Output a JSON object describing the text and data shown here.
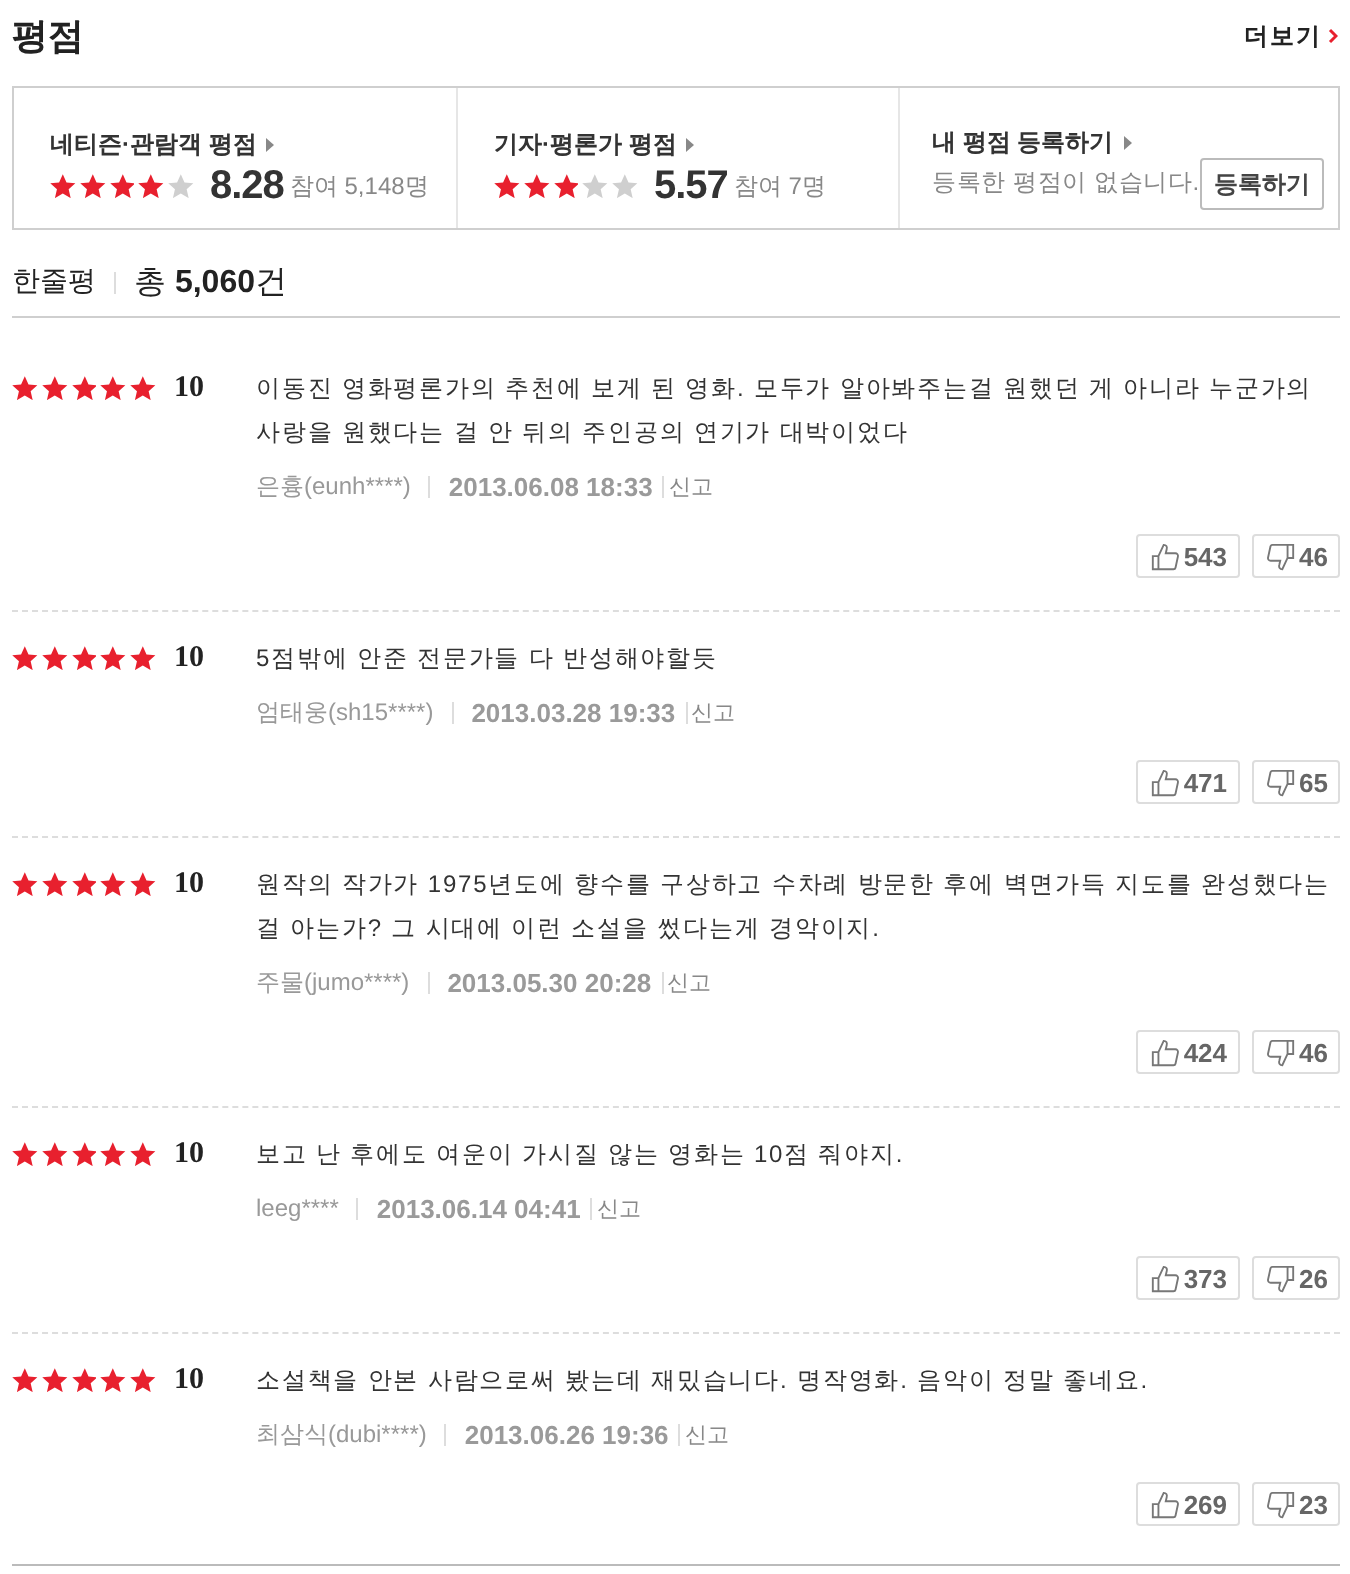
{
  "title": "평점",
  "more_link": {
    "label": "더보기"
  },
  "summary": [
    {
      "kind": "rating",
      "label": "네티즌·관람객 평점",
      "stars": 4,
      "score": "8.28",
      "participants": "참여 5,148명"
    },
    {
      "kind": "rating",
      "label": "기자·평론가 평점",
      "stars": 3,
      "score": "5.57",
      "participants": "참여 7명"
    },
    {
      "kind": "register",
      "label": "내 평점 등록하기",
      "message": "등록한 평점이 없습니다.",
      "button": "등록하기"
    }
  ],
  "comments_header": {
    "label": "한줄평",
    "total": "총 **5,060**건"
  },
  "reviews": [
    {
      "stars": 5,
      "score": "10",
      "text": "이동진 영화평론가의 추천에 보게 된 영화. 모두가 알아봐주는걸 원했던 게 아니라 누군가의 사랑을 원했다는 걸 안 뒤의 주인공의 연기가 대박이었다",
      "author": "은흉(eunh****)",
      "date": "2013.06.08 18:33",
      "report": "신고",
      "likes": "543",
      "dislikes": "46"
    },
    {
      "stars": 5,
      "score": "10",
      "text": "5점밖에 안준 전문가들 다 반성해야할듯",
      "author": "엄태웅(sh15****)",
      "date": "2013.03.28 19:33",
      "report": "신고",
      "likes": "471",
      "dislikes": "65"
    },
    {
      "stars": 5,
      "score": "10",
      "text": "원작의 작가가 1975년도에 향수를 구상하고 수차례 방문한 후에 벽면가득 지도를 완성했다는 걸 아는가? 그 시대에 이런 소설을 썼다는게 경악이지.",
      "author": "주물(jumo****)",
      "date": "2013.05.30 20:28",
      "report": "신고",
      "likes": "424",
      "dislikes": "46"
    },
    {
      "stars": 5,
      "score": "10",
      "text": "보고 난 후에도 여운이 가시질 않는 영화는 10점 줘야지.",
      "author": "leeg****",
      "date": "2013.06.14 04:41",
      "report": "신고",
      "likes": "373",
      "dislikes": "26"
    },
    {
      "stars": 5,
      "score": "10",
      "text": "소설책을 안본 사람으로써 봤는데 재밌습니다. 명작영화. 음악이 정말 좋네요.",
      "author": "최삼식(dubi****)",
      "date": "2013.06.26 19:36",
      "report": "신고",
      "likes": "269",
      "dislikes": "23"
    }
  ]
}
